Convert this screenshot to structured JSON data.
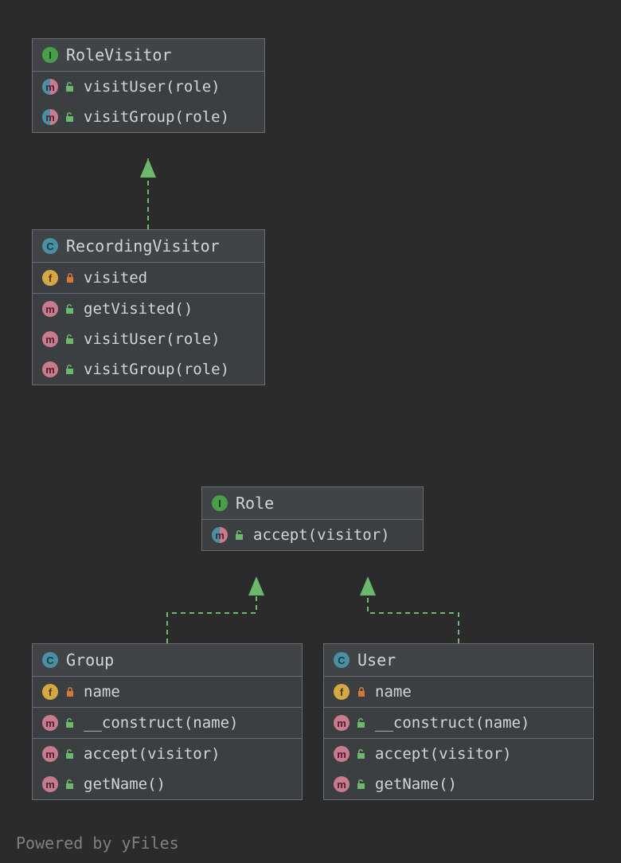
{
  "boxes": {
    "roleVisitor": {
      "title": "RoleVisitor",
      "kind": "I",
      "methods": [
        "visitUser(role)",
        "visitGroup(role)"
      ]
    },
    "recordingVisitor": {
      "title": "RecordingVisitor",
      "kind": "C",
      "fields": [
        "visited"
      ],
      "methods": [
        "getVisited()",
        "visitUser(role)",
        "visitGroup(role)"
      ]
    },
    "role": {
      "title": "Role",
      "kind": "I",
      "methods": [
        "accept(visitor)"
      ]
    },
    "group": {
      "title": "Group",
      "kind": "C",
      "fields": [
        "name"
      ],
      "methods": [
        "__construct(name)",
        "accept(visitor)",
        "getName()"
      ]
    },
    "user": {
      "title": "User",
      "kind": "C",
      "fields": [
        "name"
      ],
      "methods": [
        "__construct(name)",
        "accept(visitor)",
        "getName()"
      ]
    }
  },
  "footer": "Powered by yFiles",
  "glyphs": {
    "I": "I",
    "C": "C",
    "m": "m",
    "f": "f"
  }
}
